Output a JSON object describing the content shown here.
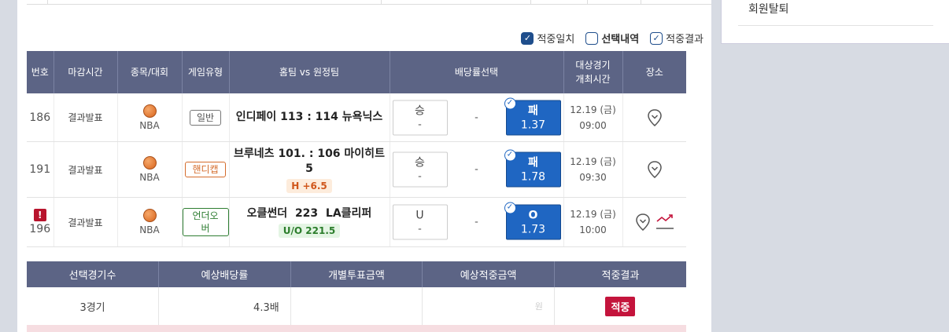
{
  "filters": [
    {
      "label": "적중일치",
      "state": "checked"
    },
    {
      "label": "선택내역",
      "state": "unchecked"
    },
    {
      "label": "적중결과",
      "state": "outline-checked"
    }
  ],
  "table": {
    "headers": [
      "번호",
      "마감시간",
      "종목/대회",
      "게임유형",
      "홈팀 vs 원정팀",
      "배당률선택",
      "대상경기\n개최시간",
      "장소"
    ],
    "header_hosting_line1": "대상경기",
    "header_hosting_line2": "개최시간",
    "rows": [
      {
        "no": "186",
        "alert": "",
        "status": "결과발표",
        "league": "NBA",
        "type": "일반",
        "type_style": "general",
        "matchup": "인디페이 113 : 114 뉴욕닉스",
        "sub": "",
        "left_label": "승",
        "left_odds": "-",
        "mid": "-",
        "right_label": "패",
        "right_odds": "1.37",
        "date": "12.19 (금)",
        "time": "09:00"
      },
      {
        "no": "191",
        "alert": "",
        "status": "결과발표",
        "league": "NBA",
        "type": "핸디캡",
        "type_style": "handicap",
        "matchup": "브루네츠 101. : 106 마이히트 5",
        "sub": "H +6.5",
        "left_label": "승",
        "left_odds": "-",
        "mid": "-",
        "right_label": "패",
        "right_odds": "1.78",
        "date": "12.19 (금)",
        "time": "09:30"
      },
      {
        "no": "196",
        "alert": "!",
        "status": "결과발표",
        "league": "NBA",
        "type": "언더오버",
        "type_style": "ou",
        "matchup": "오클썬더  223  LA클리퍼",
        "sub": "U/O 221.5",
        "left_label": "U",
        "left_odds": "-",
        "mid": "-",
        "right_label": "O",
        "right_odds": "1.73",
        "date": "12.19 (금)",
        "time": "10:00"
      }
    ]
  },
  "summary": {
    "headers": [
      "선택경기수",
      "예상배당률",
      "개별투표금액",
      "예상적중금액",
      "적중결과"
    ],
    "game_count": "3경기",
    "expected_rate": "4.3배",
    "win_amount_suffix": "원",
    "result": "적중"
  },
  "sidebar": {
    "withdraw_label": "회원탈퇴"
  },
  "colors": {
    "header_bg": "#5c6485",
    "selected_odds": "#1f66c2",
    "win_badge": "#c4143c",
    "check_blue": "#1f4e8c"
  },
  "icons": {
    "sport": "basketball-icon",
    "venue": "location-pin-icon",
    "trend": "trend-chart-icon",
    "selected": "check-circle-icon"
  }
}
